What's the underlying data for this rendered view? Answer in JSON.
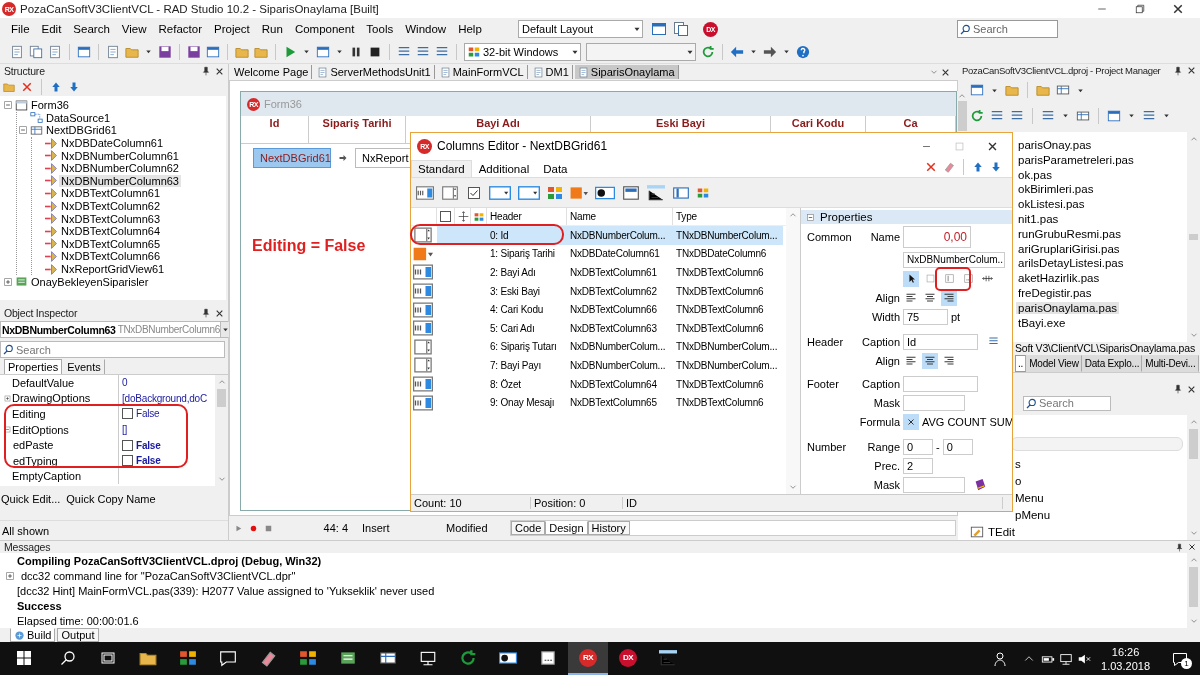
{
  "window": {
    "badge": "RX",
    "title": "PozaCanSoftV3ClientVCL - RAD Studio 10.2 - SiparisOnaylama [Built]"
  },
  "menu": [
    "File",
    "Edit",
    "Search",
    "View",
    "Refactor",
    "Project",
    "Run",
    "Component",
    "Tools",
    "Window",
    "Help"
  ],
  "layout_combo": {
    "value": "Default Layout"
  },
  "dx_badge": "DX",
  "search": {
    "placeholder": "Search"
  },
  "platform_combo": {
    "value": "32-bit Windows"
  },
  "structure": {
    "title": "Structure",
    "tree": [
      {
        "label": "Form36",
        "kind": "form",
        "expanded": true,
        "selected": false,
        "children": [
          {
            "label": "DataSource1",
            "kind": "datasource",
            "selected": false
          },
          {
            "label": "NextDBGrid61",
            "kind": "grid",
            "expanded": true,
            "selected": false,
            "children": [
              {
                "label": "NxDBDateColumn61",
                "kind": "column",
                "selected": false
              },
              {
                "label": "NxDBNumberColumn61",
                "kind": "column",
                "selected": false
              },
              {
                "label": "NxDBNumberColumn62",
                "kind": "column",
                "selected": false
              },
              {
                "label": "NxDBNumberColumn63",
                "kind": "column",
                "selected": true
              },
              {
                "label": "NxDBTextColumn61",
                "kind": "column",
                "selected": false
              },
              {
                "label": "NxDBTextColumn62",
                "kind": "column",
                "selected": false
              },
              {
                "label": "NxDBTextColumn63",
                "kind": "column",
                "selected": false
              },
              {
                "label": "NxDBTextColumn64",
                "kind": "column",
                "selected": false
              },
              {
                "label": "NxDBTextColumn65",
                "kind": "column",
                "selected": false
              },
              {
                "label": "NxDBTextColumn66",
                "kind": "column",
                "selected": false
              },
              {
                "label": "NxReportGridView61",
                "kind": "column",
                "selected": false
              }
            ]
          }
        ]
      },
      {
        "label": "OnayBekleyenSiparisler",
        "kind": "query",
        "expanded": false,
        "selected": false
      }
    ]
  },
  "object_inspector": {
    "title": "Object Inspector",
    "object": "NxDBNumberColumn63",
    "class": "TNxDBNumberColumn6",
    "search_placeholder": "Search",
    "tabs": [
      {
        "label": "Properties",
        "selected": true
      },
      {
        "label": "Events",
        "selected": false
      }
    ],
    "properties": [
      {
        "name": "DefaultValue",
        "value": "0",
        "kind": "text"
      },
      {
        "name": "DrawingOptions",
        "value": "[doBackground,doC",
        "kind": "set",
        "expanded": false
      },
      {
        "name": "Editing",
        "value": "False",
        "kind": "bool",
        "checked": false
      },
      {
        "name": "EditOptions",
        "value": "[]",
        "kind": "set",
        "expanded": true,
        "children": [
          {
            "name": "edPaste",
            "value": "False",
            "kind": "bool",
            "checked": false,
            "modified": true
          },
          {
            "name": "edTyping",
            "value": "False",
            "kind": "bool",
            "checked": false,
            "modified": true
          }
        ]
      },
      {
        "name": "EmptyCaption",
        "kind": "text"
      }
    ],
    "links": [
      "Quick Edit...",
      "Quick Copy Name"
    ],
    "status": "All shown"
  },
  "annotation": {
    "text": "Editing = False"
  },
  "editor_tabs": [
    {
      "label": "Welcome Page",
      "selected": false
    },
    {
      "label": "ServerMethodsUnit1",
      "selected": false
    },
    {
      "label": "MainFormVCL",
      "selected": false
    },
    {
      "label": "DM1",
      "selected": false
    },
    {
      "label": "SiparisOnaylama",
      "selected": true
    }
  ],
  "designer": {
    "badge": "RX",
    "form_title": "Form36",
    "grid_columns": [
      "Id",
      "Sipariş Tarihi",
      "Bayi Adı",
      "Eski Bayi",
      "Cari Kodu",
      "Ca"
    ],
    "breadcrumb": [
      {
        "label": "NextDBGrid61",
        "selected": true
      },
      {
        "label": "NxReport",
        "selected": false
      }
    ]
  },
  "editor_status": {
    "position": "44:  4",
    "mode": "Insert",
    "state": "Modified",
    "tabs": [
      {
        "label": "Code",
        "selected": false
      },
      {
        "label": "Design",
        "selected": true
      },
      {
        "label": "History",
        "selected": false
      }
    ]
  },
  "columns_editor": {
    "badge": "RX",
    "title": "Columns Editor - NextDBGrid61",
    "tabs": [
      {
        "label": "Standard",
        "selected": true
      },
      {
        "label": "Additional",
        "selected": false
      },
      {
        "label": "Data",
        "selected": false
      }
    ],
    "header_checkbox": {
      "checked": false
    },
    "columns": [
      "Header",
      "Name",
      "Type"
    ],
    "rows": [
      {
        "kind": "number",
        "header": "0: Id",
        "name": "NxDBNumberColum...",
        "type": "TNxDBNumberColum...",
        "selected": true
      },
      {
        "kind": "date",
        "header": "1: Sipariş Tarihi",
        "name": "NxDBDateColumn61",
        "type": "TNxDBDateColumn6",
        "selected": false
      },
      {
        "kind": "text",
        "header": "2: Bayi Adı",
        "name": "NxDBTextColumn61",
        "type": "TNxDBTextColumn6",
        "selected": false
      },
      {
        "kind": "text",
        "header": "3: Eski Bayi",
        "name": "NxDBTextColumn62",
        "type": "TNxDBTextColumn6",
        "selected": false
      },
      {
        "kind": "text",
        "header": "4: Cari Kodu",
        "name": "NxDBTextColumn66",
        "type": "TNxDBTextColumn6",
        "selected": false
      },
      {
        "kind": "text",
        "header": "5: Cari Adı",
        "name": "NxDBTextColumn63",
        "type": "TNxDBTextColumn6",
        "selected": false
      },
      {
        "kind": "number",
        "header": "6: Sipariş Tutarı",
        "name": "NxDBNumberColum...",
        "type": "TNxDBNumberColum...",
        "selected": false
      },
      {
        "kind": "number",
        "header": "7: Bayi Payı",
        "name": "NxDBNumberColum...",
        "type": "TNxDBNumberColum...",
        "selected": false
      },
      {
        "kind": "text",
        "header": "8: Özet",
        "name": "NxDBTextColumn64",
        "type": "TNxDBTextColumn6",
        "selected": false
      },
      {
        "kind": "text",
        "header": "9: Onay Mesajı",
        "name": "NxDBTextColumn65",
        "type": "TNxDBTextColumn6",
        "selected": false
      }
    ],
    "panel": {
      "title": "Properties",
      "expanded": true,
      "common": {
        "label": "Common",
        "value": "0,00",
        "name_label": "Name",
        "name_value": "NxDBNumberColum...",
        "modes": [
          {
            "kind": "pointer",
            "selected": true
          },
          {
            "kind": "box",
            "selected": false
          },
          {
            "kind": "bar",
            "selected": false
          },
          {
            "kind": "dots",
            "selected": false
          },
          {
            "kind": "resize",
            "selected": false
          }
        ],
        "align_label": "Align",
        "aligns": [
          {
            "kind": "left",
            "selected": false
          },
          {
            "kind": "center",
            "selected": false
          },
          {
            "kind": "right",
            "selected": true
          }
        ],
        "width_label": "Width",
        "width_value": "75",
        "width_unit": "pt"
      },
      "header": {
        "label": "Header",
        "caption_label": "Caption",
        "caption_value": "Id",
        "align_label": "Align",
        "aligns": [
          {
            "kind": "left",
            "selected": false
          },
          {
            "kind": "center",
            "selected": true
          },
          {
            "kind": "right",
            "selected": false
          }
        ]
      },
      "footer": {
        "label": "Footer",
        "caption_label": "Caption",
        "mask_label": "Mask",
        "formula_label": "Formula",
        "formulas": [
          "AVG",
          "COUNT",
          "SUM"
        ]
      },
      "number": {
        "label": "Number",
        "range_label": "Range",
        "range_from": "0",
        "range_sep": "-",
        "range_to": "0",
        "prec_label": "Prec.",
        "prec_value": "2",
        "mask_label": "Mask"
      }
    },
    "status": [
      "Count: 10",
      "Position: 0",
      "ID"
    ]
  },
  "project_manager": {
    "title": "PozaCanSoftV3ClientVCL.dproj - Project Manager",
    "files": [
      {
        "label": "parisOnay.pas",
        "selected": false
      },
      {
        "label": "parisParametreleri.pas",
        "selected": false
      },
      {
        "label": "ok.pas",
        "selected": false
      },
      {
        "label": "okBirimleri.pas",
        "selected": false
      },
      {
        "label": "okListesi.pas",
        "selected": false
      },
      {
        "label": "nit1.pas",
        "selected": false
      },
      {
        "label": "runGrubuResmi.pas",
        "selected": false
      },
      {
        "label": "ariGruplariGirisi.pas",
        "selected": false
      },
      {
        "label": "arilsDetayListesi.pas",
        "selected": false
      },
      {
        "label": "aketHazirlik.pas",
        "selected": false
      },
      {
        "label": "freDegistir.pas",
        "selected": false
      },
      {
        "label": "parisOnaylama.pas",
        "selected": true
      },
      {
        "label": "tBayi.exe",
        "selected": false
      }
    ],
    "path": "Soft V3\\ClientVCL\\SiparisOnaylama.pas",
    "tabs": [
      {
        "label": "..",
        "selected": true
      },
      {
        "label": "Model View",
        "selected": false
      },
      {
        "label": "Data Explo...",
        "selected": false
      },
      {
        "label": "Multi-Devi...",
        "selected": false
      }
    ]
  },
  "palette": {
    "search_placeholder": "Search",
    "items": [
      "s",
      "o",
      "Menu",
      "pMenu",
      "TEdit"
    ]
  },
  "messages": {
    "title": "Messages",
    "lines": [
      {
        "text": "Compiling PozaCanSoftV3ClientVCL.dproj (Debug, Win32)",
        "kind": "bold"
      },
      {
        "text": "dcc32 command line for \"PozaCanSoftV3ClientVCL.dpr\"",
        "kind": "expandable"
      },
      {
        "text": "[dcc32 Hint] MainFormVCL.pas(339): H2077 Value assigned to 'Yukseklik' never used",
        "kind": "plain"
      },
      {
        "text": "Success",
        "kind": "bold"
      },
      {
        "text": "Elapsed time: 00:00:01.6",
        "kind": "plain"
      }
    ],
    "tabs": [
      {
        "label": "Build",
        "selected": true
      },
      {
        "label": "Output",
        "selected": false
      }
    ]
  },
  "taskbar": {
    "apps": [
      {
        "kind": "folder",
        "selected": false
      },
      {
        "kind": "store",
        "selected": false
      },
      {
        "kind": "mail",
        "selected": false
      },
      {
        "kind": "usb",
        "selected": false
      },
      {
        "kind": "cube",
        "selected": false
      },
      {
        "kind": "server",
        "selected": false
      },
      {
        "kind": "lock",
        "selected": false
      },
      {
        "kind": "monitor",
        "selected": false
      },
      {
        "kind": "browser",
        "selected": false
      },
      {
        "kind": "chrome",
        "selected": false
      },
      {
        "kind": "dots",
        "selected": false
      },
      {
        "kind": "badge",
        "label": "RX",
        "color": "#d62a2a",
        "selected": true
      },
      {
        "kind": "badge",
        "label": "DX",
        "color": "#c8102e",
        "selected": false
      },
      {
        "kind": "chart",
        "selected": false
      }
    ],
    "time": "16:26",
    "date": "1.03.2018",
    "notifications": "1"
  }
}
